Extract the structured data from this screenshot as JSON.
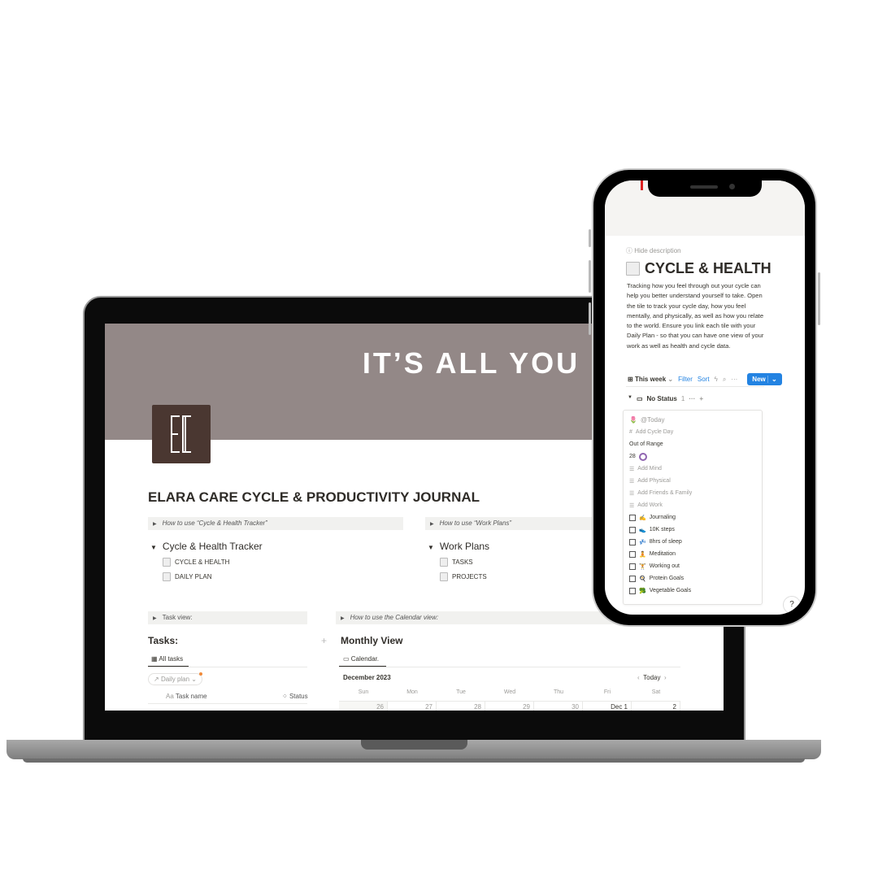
{
  "laptop": {
    "banner_title": "IT’S ALL YOU",
    "logo_letters": "EC",
    "page_title": "ELARA CARE CYCLE & PRODUCTIVITY JOURNAL",
    "toggles": {
      "cycle": "How to use “Cycle & Health Tracker”",
      "work": "How to use “Work Plans”",
      "task": "Task view:",
      "calendar": "How to use the Calendar view:"
    },
    "cycle_section": {
      "title": "Cycle & Health Tracker",
      "links": [
        "CYCLE & HEALTH",
        "DAILY PLAN"
      ]
    },
    "work_section": {
      "title": "Work Plans",
      "links": [
        "TASKS",
        "PROJECTS"
      ]
    },
    "tasks": {
      "title": "Tasks:",
      "tab": "All tasks",
      "filter": "Daily plan",
      "columns": [
        "Task name",
        "Status"
      ],
      "col_prefix": "Aa"
    },
    "calendar": {
      "title": "Monthly View",
      "tab": "Calendar.",
      "month": "December 2023",
      "today": "Today",
      "days": [
        "Sun",
        "Mon",
        "Tue",
        "Wed",
        "Thu",
        "Fri",
        "Sat"
      ],
      "dates": [
        "26",
        "27",
        "28",
        "29",
        "30",
        "Dec 1",
        "2"
      ]
    }
  },
  "phone": {
    "hide_description": "Hide description",
    "title": "CYCLE & HEALTH",
    "description": "Tracking how you feel through out your cycle can help you better understand yourself to take. Open the tile to track your cycle day, how you feel mentally, and physically, as well as how you relate to the world. Ensure you link each tile with your Daily Plan - so that you can have one view of your work as well as health and cycle data.",
    "toolbar": {
      "view": "This week",
      "filter": "Filter",
      "sort": "Sort",
      "new": "New"
    },
    "group": {
      "label": "No Status",
      "count": "1"
    },
    "card": {
      "date": "@Today",
      "cycle_day": "Add Cycle Day",
      "range": "Out of Range",
      "number": "28",
      "props": [
        "Add Mind",
        "Add Physical",
        "Add Friends & Family",
        "Add Work"
      ],
      "checklist": [
        {
          "emoji": "✍️",
          "label": "Journaling"
        },
        {
          "emoji": "👟",
          "label": "10K steps"
        },
        {
          "emoji": "💤",
          "label": "8hrs of sleep"
        },
        {
          "emoji": "🧘",
          "label": "Meditation"
        },
        {
          "emoji": "🏋️",
          "label": "Working out"
        },
        {
          "emoji": "🍳",
          "label": "Protein Goals"
        },
        {
          "emoji": "🥦",
          "label": "Vegetable Goals"
        }
      ]
    },
    "help": "?"
  },
  "colors": {
    "banner": "#938887",
    "logo": "#4a3731",
    "accent_blue": "#2383e2",
    "ring": "#9065b0"
  }
}
